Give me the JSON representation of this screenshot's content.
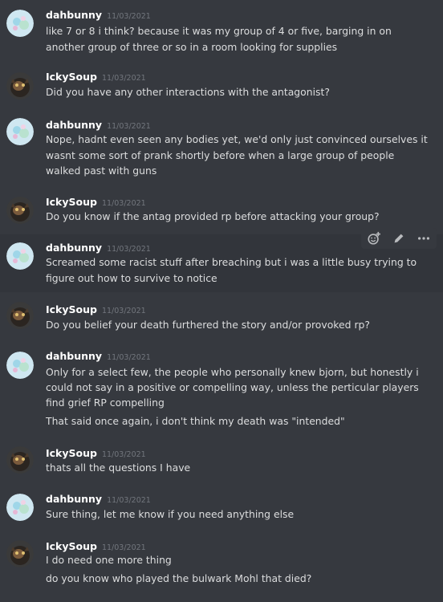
{
  "users": {
    "dahbunny": "dahbunny",
    "ickysoup": "IckySoup"
  },
  "messages": [
    {
      "author": "dahbunny",
      "timestamp": "11/03/2021",
      "lines": [
        "like 7 or 8 i think? because it was my group of 4 or five, barging in on",
        "another group of three or so in a room looking for supplies"
      ]
    },
    {
      "author": "IckySoup",
      "timestamp": "11/03/2021",
      "lines": [
        "Did you have any other interactions with the antagonist?"
      ]
    },
    {
      "author": "dahbunny",
      "timestamp": "11/03/2021",
      "lines": [
        "Nope, hadnt even seen any bodies yet, we'd only just convinced ourselves it",
        "wasnt some sort of prank shortly before when a large group of people",
        "walked past with guns"
      ]
    },
    {
      "author": "IckySoup",
      "timestamp": "11/03/2021",
      "lines": [
        "Do you know if the antag provided rp before attacking your group?"
      ]
    },
    {
      "author": "dahbunny",
      "timestamp": "11/03/2021",
      "lines": [
        "Screamed some racist stuff after breaching but i was a little busy trying to",
        "figure out how to survive to notice"
      ]
    },
    {
      "author": "IckySoup",
      "timestamp": "11/03/2021",
      "lines": [
        "Do you belief your death furthered the story  and/or provoked rp?"
      ]
    },
    {
      "author": "dahbunny",
      "timestamp": "11/03/2021",
      "lines": [
        "Only for a select few, the people who personally knew bjorn, but honestly i",
        "could not say in a positive or compelling way, unless the perticular players",
        "find grief RP compelling"
      ],
      "followup": "That said once again, i don't think my death was \"intended\""
    },
    {
      "author": "IckySoup",
      "timestamp": "11/03/2021",
      "lines": [
        "thats all the questions I have"
      ]
    },
    {
      "author": "dahbunny",
      "timestamp": "11/03/2021",
      "lines": [
        "Sure thing, let me know if you need anything else"
      ]
    },
    {
      "author": "IckySoup",
      "timestamp": "11/03/2021",
      "lines": [
        "I do need one more thing"
      ],
      "followup": "do you know who played the bulwark Mohl that died?"
    }
  ],
  "toolbar": {
    "icons": [
      "add-reaction-icon",
      "edit-pencil-icon",
      "more-options-icon"
    ]
  },
  "colors": {
    "background": "#36393f",
    "hover_background": "#32353b",
    "username": "#ffffff",
    "text": "#dcddde",
    "timestamp": "#72767d"
  }
}
